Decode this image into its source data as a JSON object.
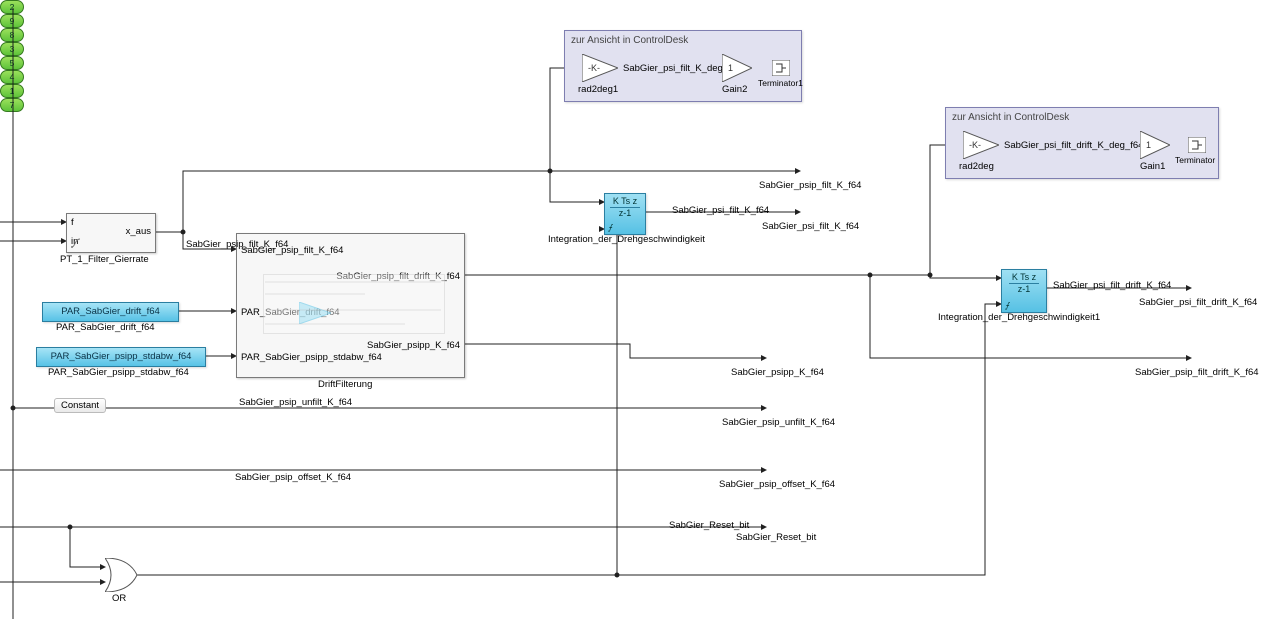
{
  "groups": {
    "g1": {
      "title": "zur Ansicht in ControlDesk"
    },
    "g2": {
      "title": "zur Ansicht in ControlDesk"
    }
  },
  "blocks": {
    "pt1": {
      "name": "PT_1_Filter_Gierrate",
      "in1": "f",
      "in2": "in",
      "out": "x_aus"
    },
    "const_drift": {
      "value": "PAR_SabGier_drift_f64",
      "label": "PAR_SabGier_drift_f64"
    },
    "const_stdabw": {
      "value": "PAR_SabGier_psipp_stdabw_f64",
      "label": "PAR_SabGier_psipp_stdabw_f64"
    },
    "drift": {
      "name": "DriftFilterung",
      "in1": "SabGier_psip_filt_K_f64",
      "in2": "PAR_SabGier_drift_f64",
      "in3": "PAR_SabGier_psipp_stdabw_f64",
      "out1": "SabGier_psip_filt_drift_K_f64",
      "out2": "SabGier_psipp_K_f64"
    },
    "integ1": {
      "name": "Integration_der_Drehgeschwindigkeit",
      "expr_top": "K Ts z",
      "expr_bot": "z-1"
    },
    "integ2": {
      "name": "Integration_der_Drehgeschwindigkeit1",
      "expr_top": "K Ts z",
      "expr_bot": "z-1"
    },
    "rad2deg1": {
      "label": "rad2deg1",
      "k": "-K-"
    },
    "rad2deg": {
      "label": "rad2deg",
      "k": "-K-"
    },
    "gain2": {
      "label": "Gain2",
      "k": "1"
    },
    "gain1": {
      "label": "Gain1",
      "k": "1"
    },
    "term1": {
      "label": "Terminator1"
    },
    "term": {
      "label": "Terminator"
    },
    "or": {
      "label": "OR"
    },
    "note": {
      "text": "Constant"
    }
  },
  "signals": {
    "sig_psip_filt_top": "SabGier_psip_filt_K_f64",
    "sig_psi_filt_deg1": "SabGier_psi_filt_K_deg_f64",
    "sig_psi_filt_drift_deg": "SabGier_psi_filt_drift_K_deg_f64",
    "sig_psi_filt": "SabGier_psi_filt_K_f64",
    "sig_psip_offset": "SabGier_psip_offset_K_f64",
    "sig_psip_unfilt": "SabGier_psip_unfilt_K_f64",
    "sig_reset_l": "SabGier_Reset_bit",
    "sig_psi_filt_drift": "SabGier_psi_filt_drift_K_f64"
  },
  "outports": {
    "p1": {
      "num": "1",
      "label": "SabGier_psi_filt_drift_K_f64"
    },
    "p2": {
      "num": "2",
      "label": "SabGier_psip_filt_K_f64"
    },
    "p3": {
      "num": "3",
      "label": "SabGier_psip_unfilt_K_f64"
    },
    "p4": {
      "num": "4",
      "label": "SabGier_Reset_bit"
    },
    "p5": {
      "num": "5",
      "label": "SabGier_psip_offset_K_f64"
    },
    "p7": {
      "num": "7",
      "label": "SabGier_psip_filt_drift_K_f64"
    },
    "p8": {
      "num": "8",
      "label": "SabGier_psipp_K_f64"
    },
    "p9": {
      "num": "9",
      "label": "SabGier_psi_filt_K_f64"
    }
  }
}
